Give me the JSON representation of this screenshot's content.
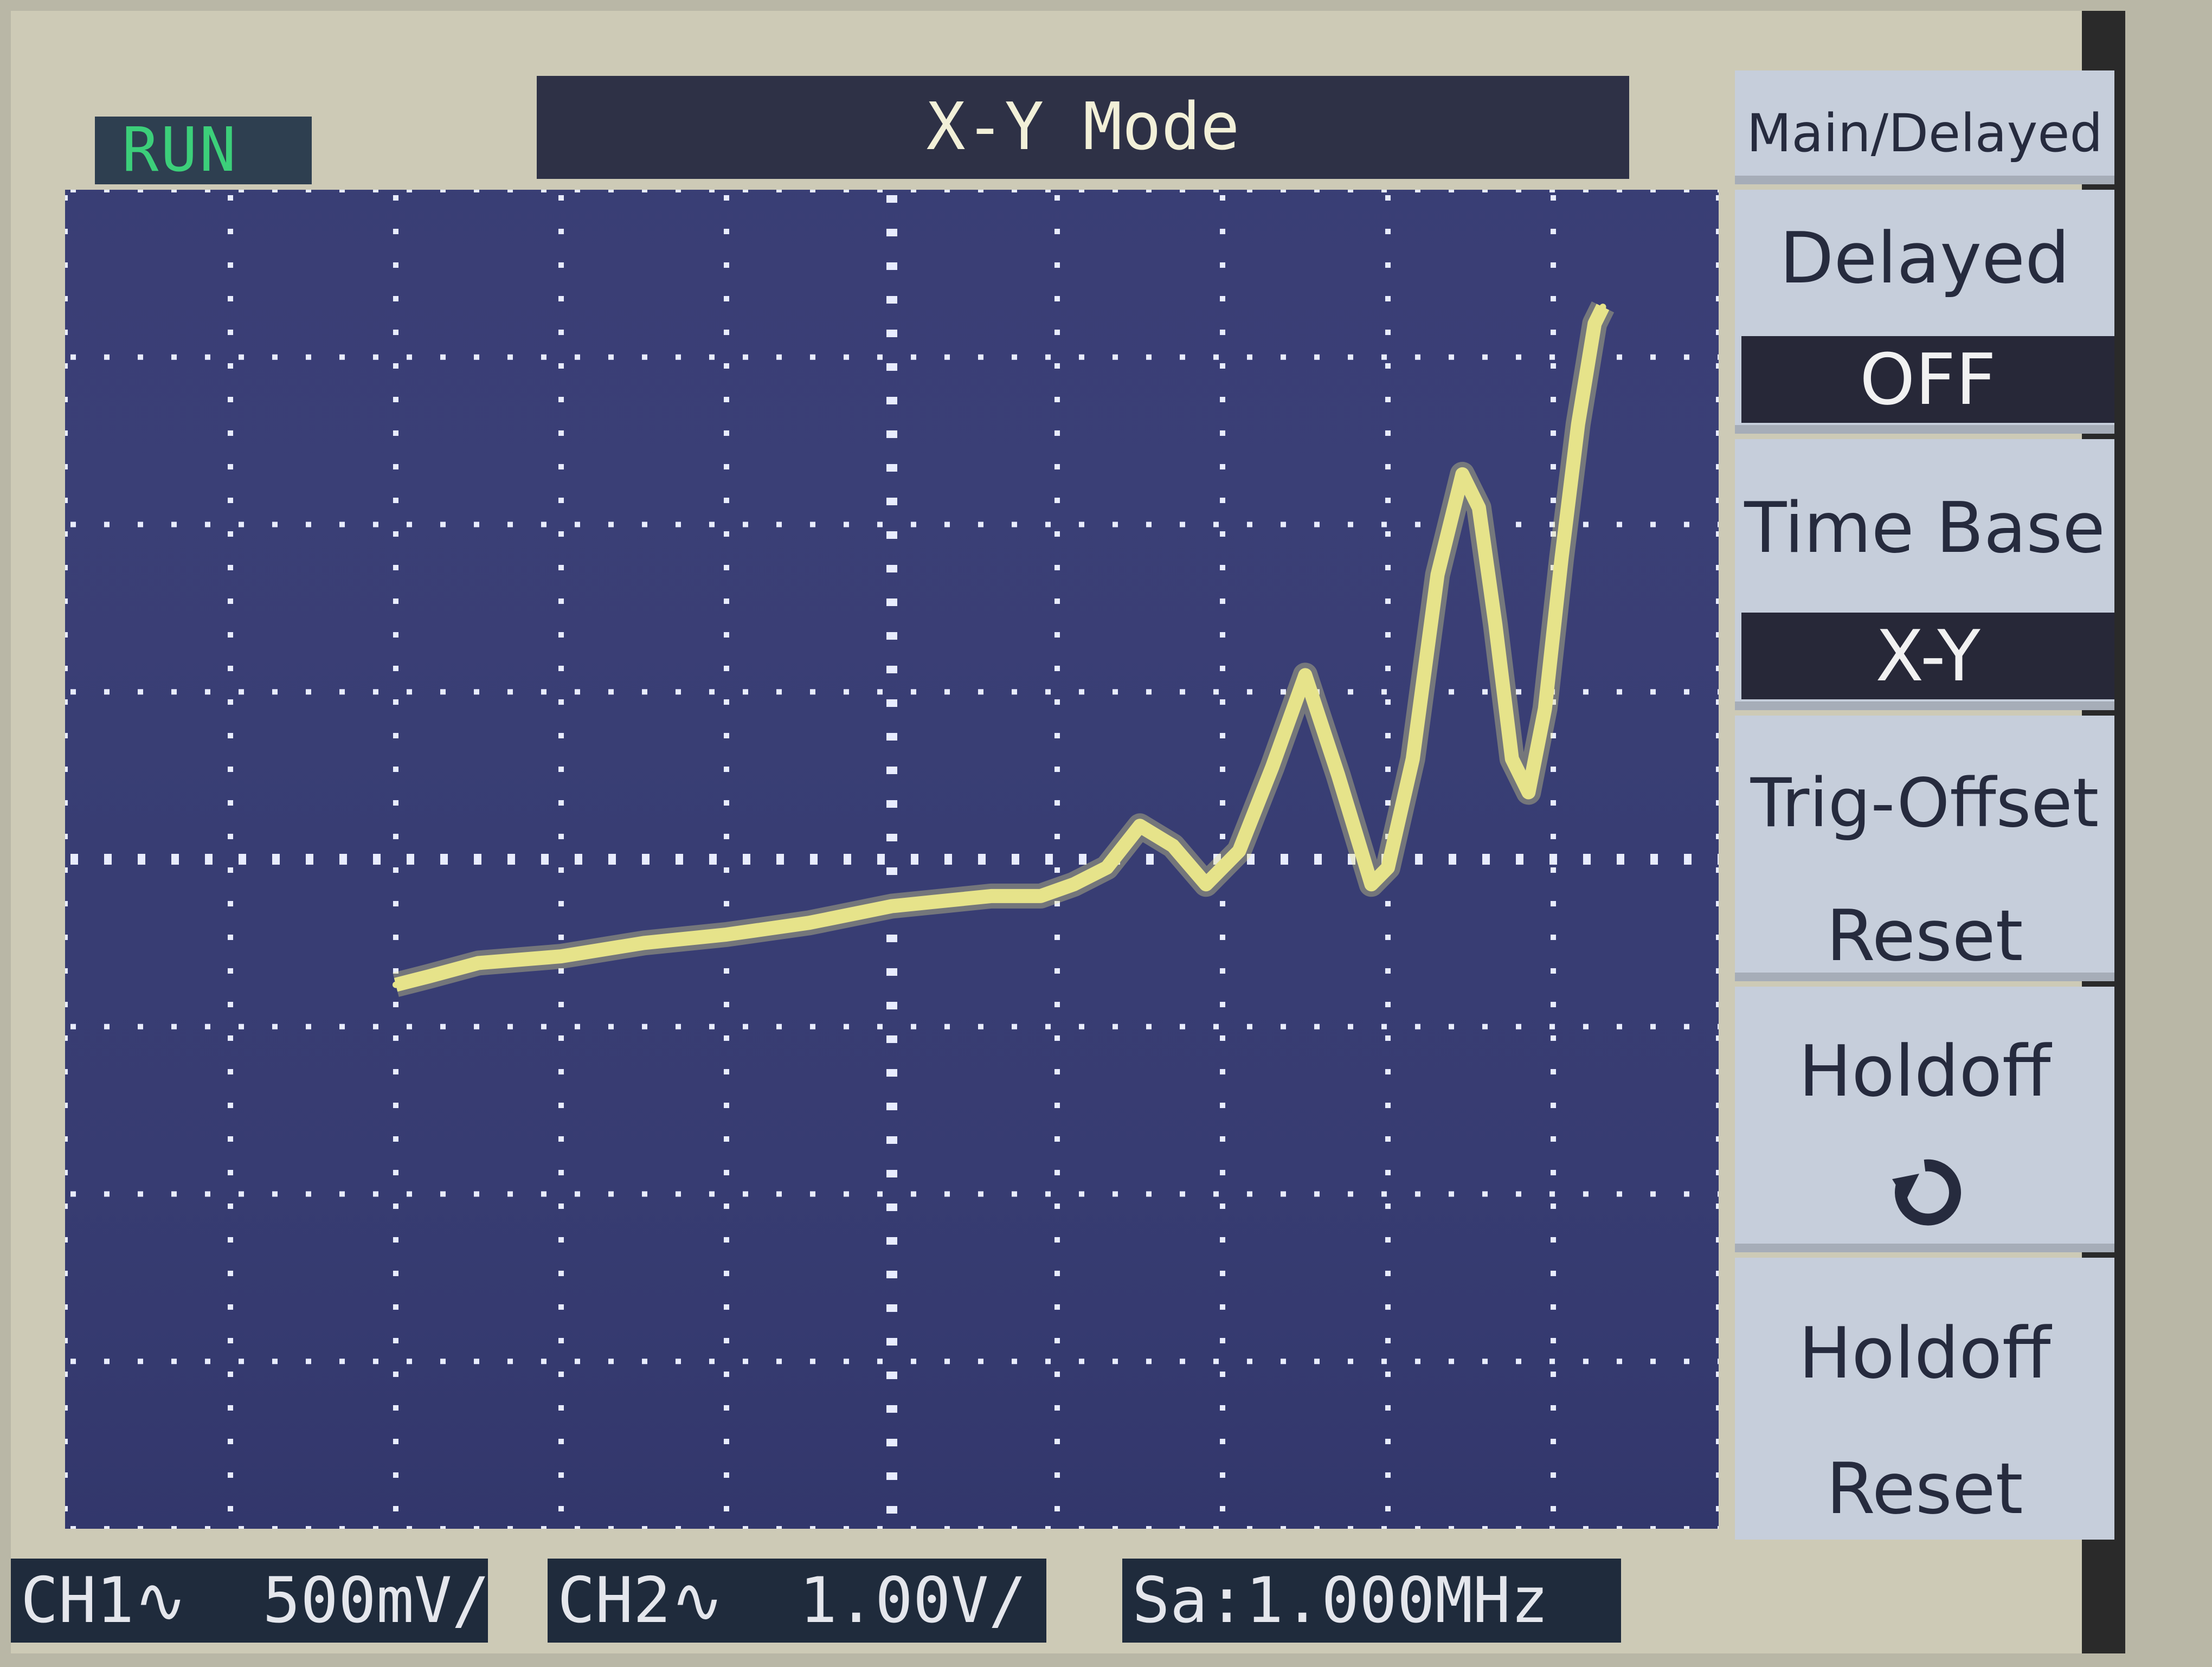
{
  "status": {
    "run": "RUN"
  },
  "header": {
    "title": "X-Y Mode"
  },
  "menu": {
    "items": [
      {
        "label": "Main/Delayed",
        "value": ""
      },
      {
        "label": "Delayed",
        "value": "OFF"
      },
      {
        "label": "Time Base",
        "value": "X-Y"
      },
      {
        "label": "Trig-Offset",
        "value": "Reset"
      },
      {
        "label": "Holdoff",
        "value": ""
      },
      {
        "label": "Holdoff",
        "value": "Reset"
      }
    ],
    "holdoff_icon": "rotate-arrow-icon"
  },
  "footer": {
    "ch1": "CH1∿  500mV/",
    "ch2": "CH2∿  1.00V/",
    "sample_rate": "Sa:1.000MHz"
  },
  "colors": {
    "trace": "#e6e38a",
    "grid_dots": "#e8ecff",
    "screen_bg": "#2f3468",
    "menu_bg": "#c6cedb",
    "run_text": "#3ccf7a"
  },
  "chart_data": {
    "type": "line",
    "title": "",
    "xlabel": "",
    "ylabel": "",
    "xlim": [
      -5,
      5
    ],
    "ylim": [
      -4,
      4
    ],
    "grid": true,
    "series": [
      {
        "name": "",
        "x": [
          -3.0,
          -2.8,
          -2.5,
          -2.0,
          -1.5,
          -1.0,
          -0.5,
          0.0,
          0.3,
          0.6,
          0.9,
          1.1,
          1.3,
          1.5,
          1.7,
          1.9,
          2.1,
          2.3,
          2.5,
          2.7,
          2.9,
          3.0,
          3.15,
          3.3,
          3.45,
          3.55,
          3.65,
          3.75,
          3.85,
          3.95,
          4.05,
          4.15,
          4.25,
          4.3
        ],
        "y": [
          -0.75,
          -0.7,
          -0.62,
          -0.58,
          -0.5,
          -0.45,
          -0.38,
          -0.28,
          -0.25,
          -0.22,
          -0.22,
          -0.15,
          -0.05,
          0.2,
          0.08,
          -0.15,
          0.05,
          0.55,
          1.1,
          0.5,
          -0.15,
          -0.05,
          0.6,
          1.7,
          2.3,
          2.1,
          1.4,
          0.6,
          0.4,
          0.9,
          1.8,
          2.6,
          3.2,
          3.3
        ]
      }
    ]
  }
}
